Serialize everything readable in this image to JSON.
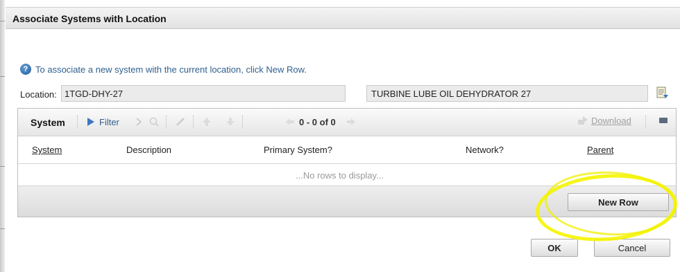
{
  "dialog": {
    "title": "Associate Systems with Location"
  },
  "hint": {
    "text": "To associate a new system with the current location, click New Row."
  },
  "location": {
    "label": "Location:",
    "value": "1TGD-DHY-27",
    "description": "TURBINE LUBE OIL DEHYDRATOR 27"
  },
  "table": {
    "title": "System",
    "filter_label": "Filter",
    "pager_text": "0 - 0 of 0",
    "download_label": "Download",
    "columns": [
      "System",
      "Description",
      "Primary System?",
      "Network?",
      "Parent"
    ],
    "empty_text": "...No rows to display...",
    "new_row_label": "New Row"
  },
  "buttons": {
    "ok_label": "OK",
    "cancel_label": "Cancel"
  },
  "colors": {
    "accent": "#2f5f8f",
    "highlight": "#f5f500"
  }
}
